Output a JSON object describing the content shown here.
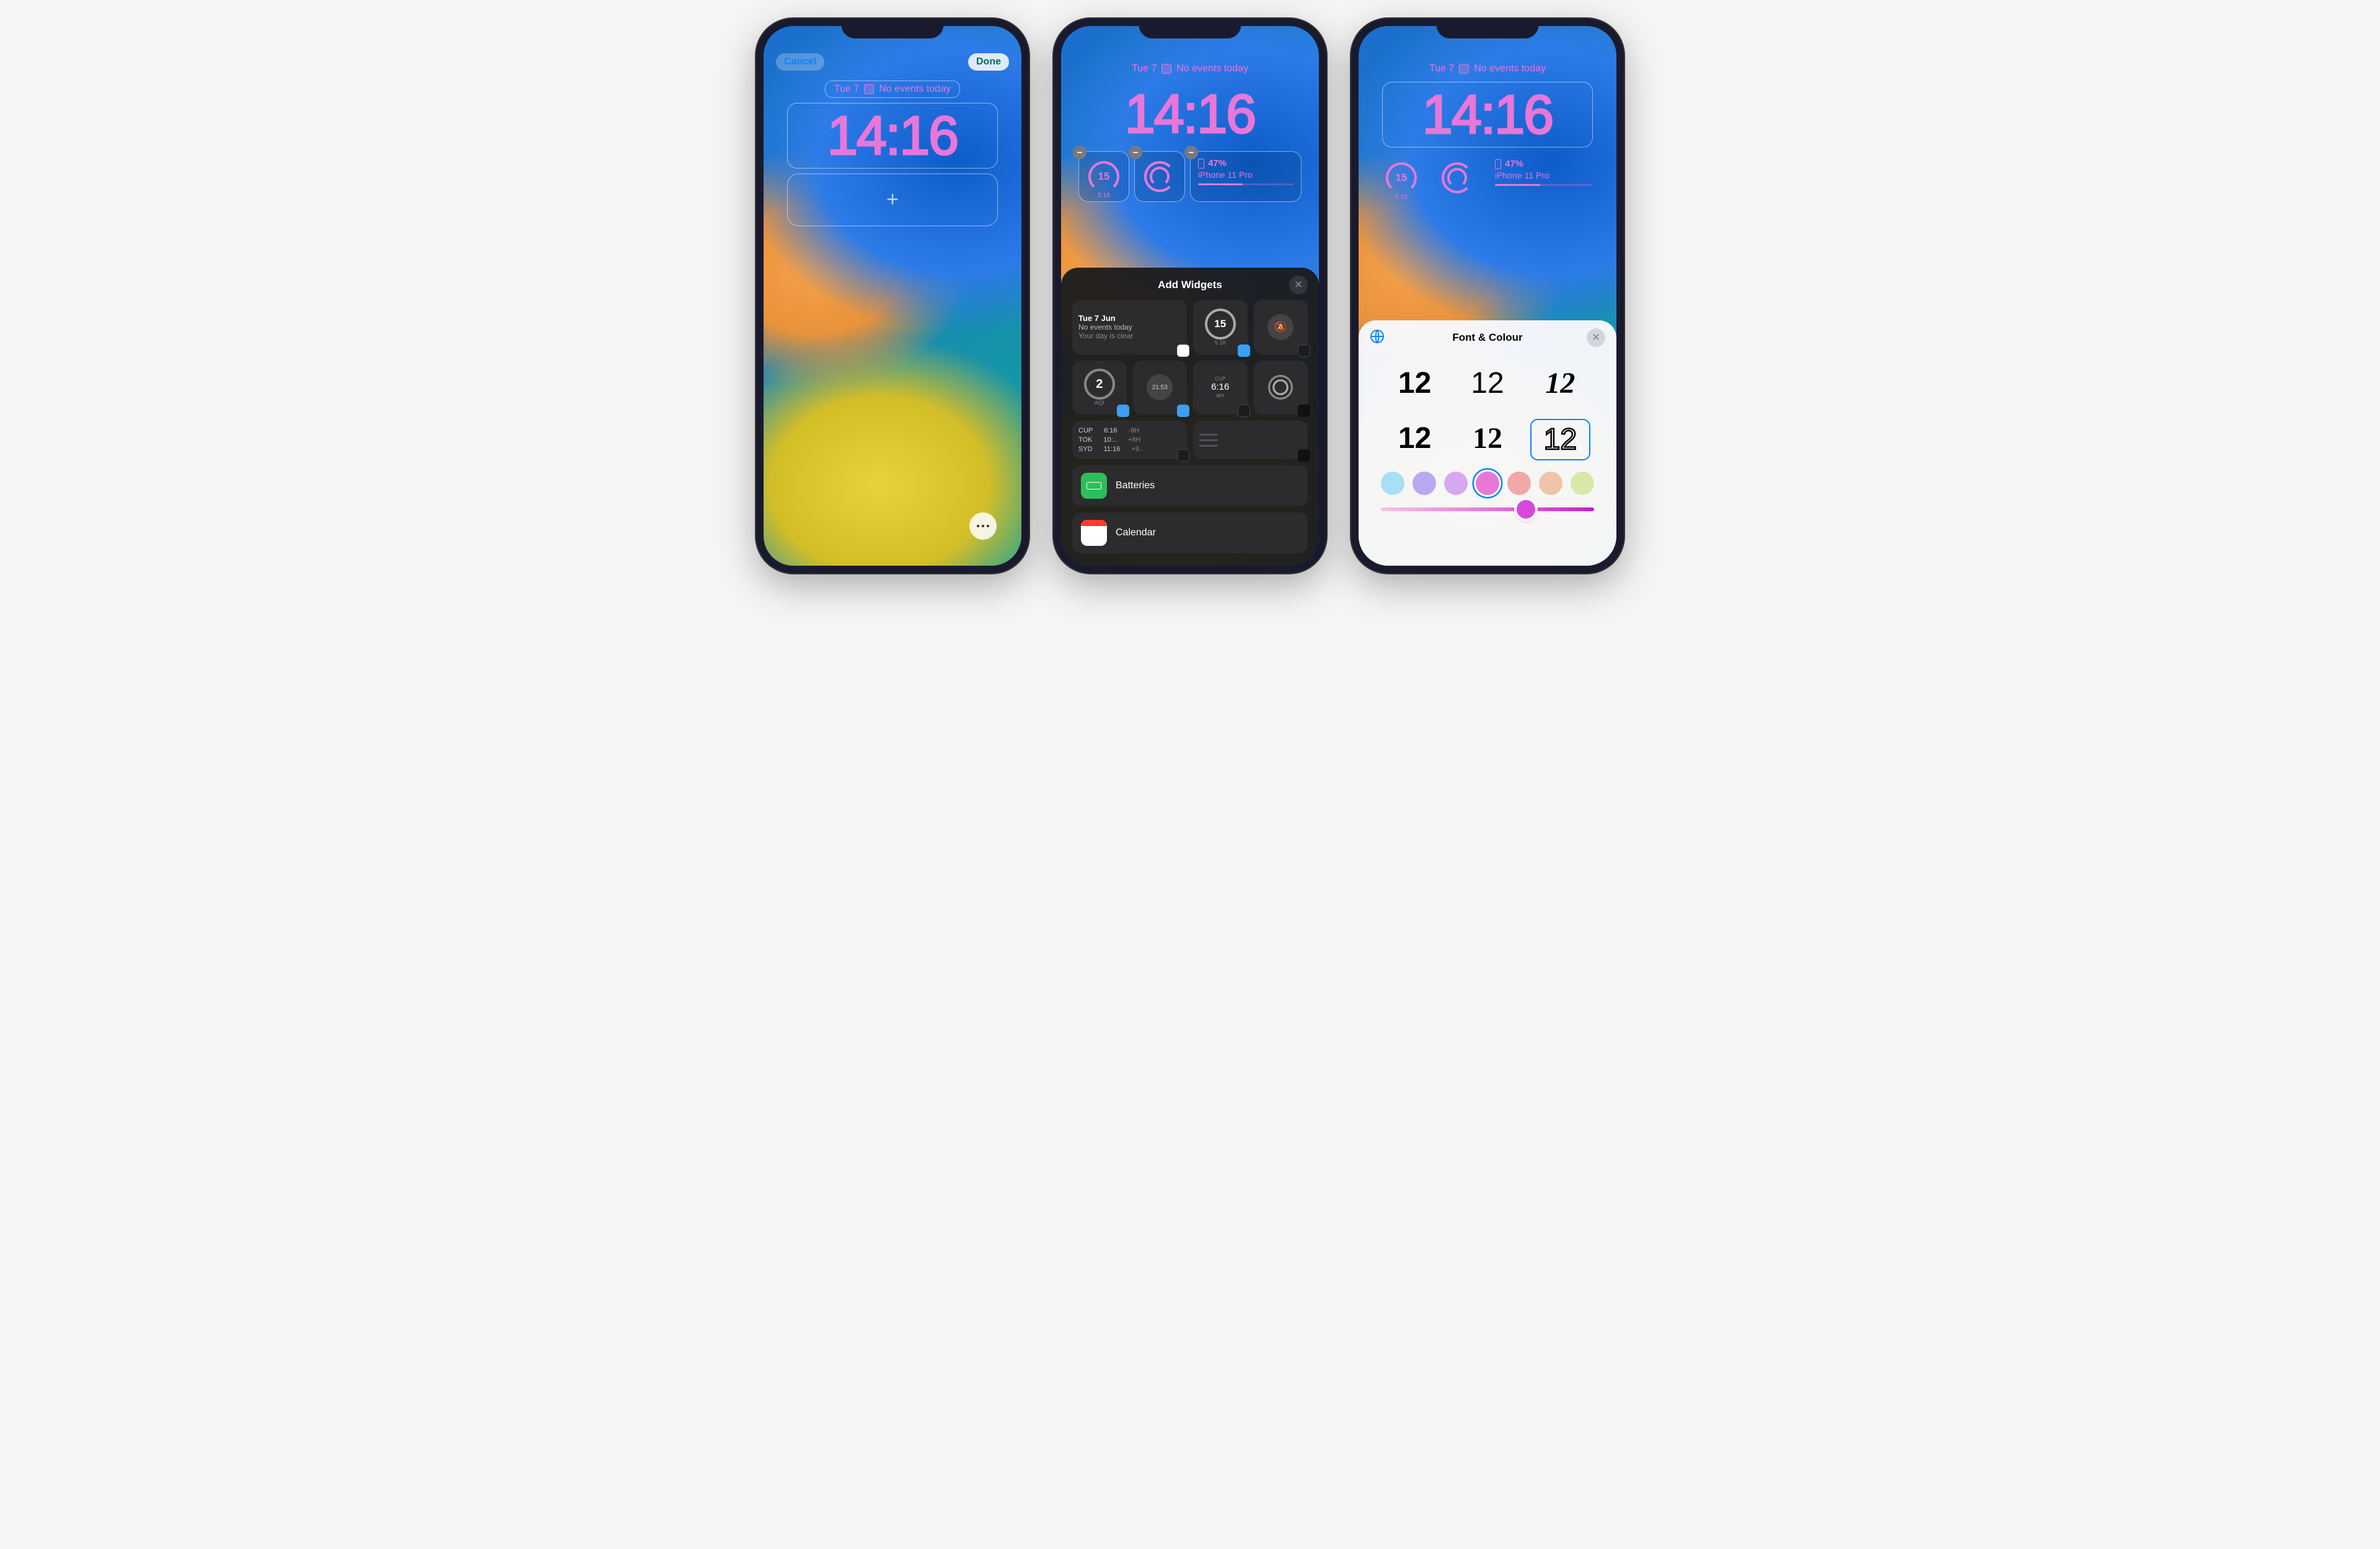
{
  "phone1": {
    "cancel": "Cancel",
    "done": "Done",
    "date": "Tue 7",
    "events": "No events today",
    "time": "14:16"
  },
  "phone2": {
    "date": "Tue 7",
    "events": "No events today",
    "time": "14:16",
    "w1_val": "15",
    "w1_sub": "5 16",
    "w3_pct": "47%",
    "w3_dev": "iPhone 11 Pro",
    "sheet_title": "Add Widgets",
    "sug_date": "Tue 7 Jun",
    "sug_ev": "No events today",
    "sug_clear": "Your day is clear",
    "sug_aqi_val": "2",
    "sug_aqi_lbl": "AQI",
    "sug_time": "21:53",
    "sug_cup_lbl": "CUP",
    "sug_cup_t": "6:16",
    "sug_cup_ampm": "am",
    "worldclock": {
      "c1": "CUP",
      "t1": "6:16",
      "o1": "-8H",
      "c2": "TOK",
      "t2": "10:..",
      "o2": "+8H",
      "c3": "SYD",
      "t3": "11:16",
      "o3": "+9.."
    },
    "sug_prev_val": "15",
    "sug_prev_sub": "5 16",
    "app1": "Batteries",
    "app2": "Calendar"
  },
  "phone3": {
    "date": "Tue 7",
    "events": "No events today",
    "time": "14:16",
    "w1_val": "15",
    "w1_sub": "5 16",
    "w3_pct": "47%",
    "w3_dev": "iPhone 11 Pro",
    "sheet_title": "Font & Colour",
    "fsample": "12",
    "colors": [
      "#a8dff5",
      "#b8a8f0",
      "#d6a8f0",
      "#e877d8",
      "#f0a8a8",
      "#f0c4a8",
      "#d8e8a8"
    ]
  }
}
